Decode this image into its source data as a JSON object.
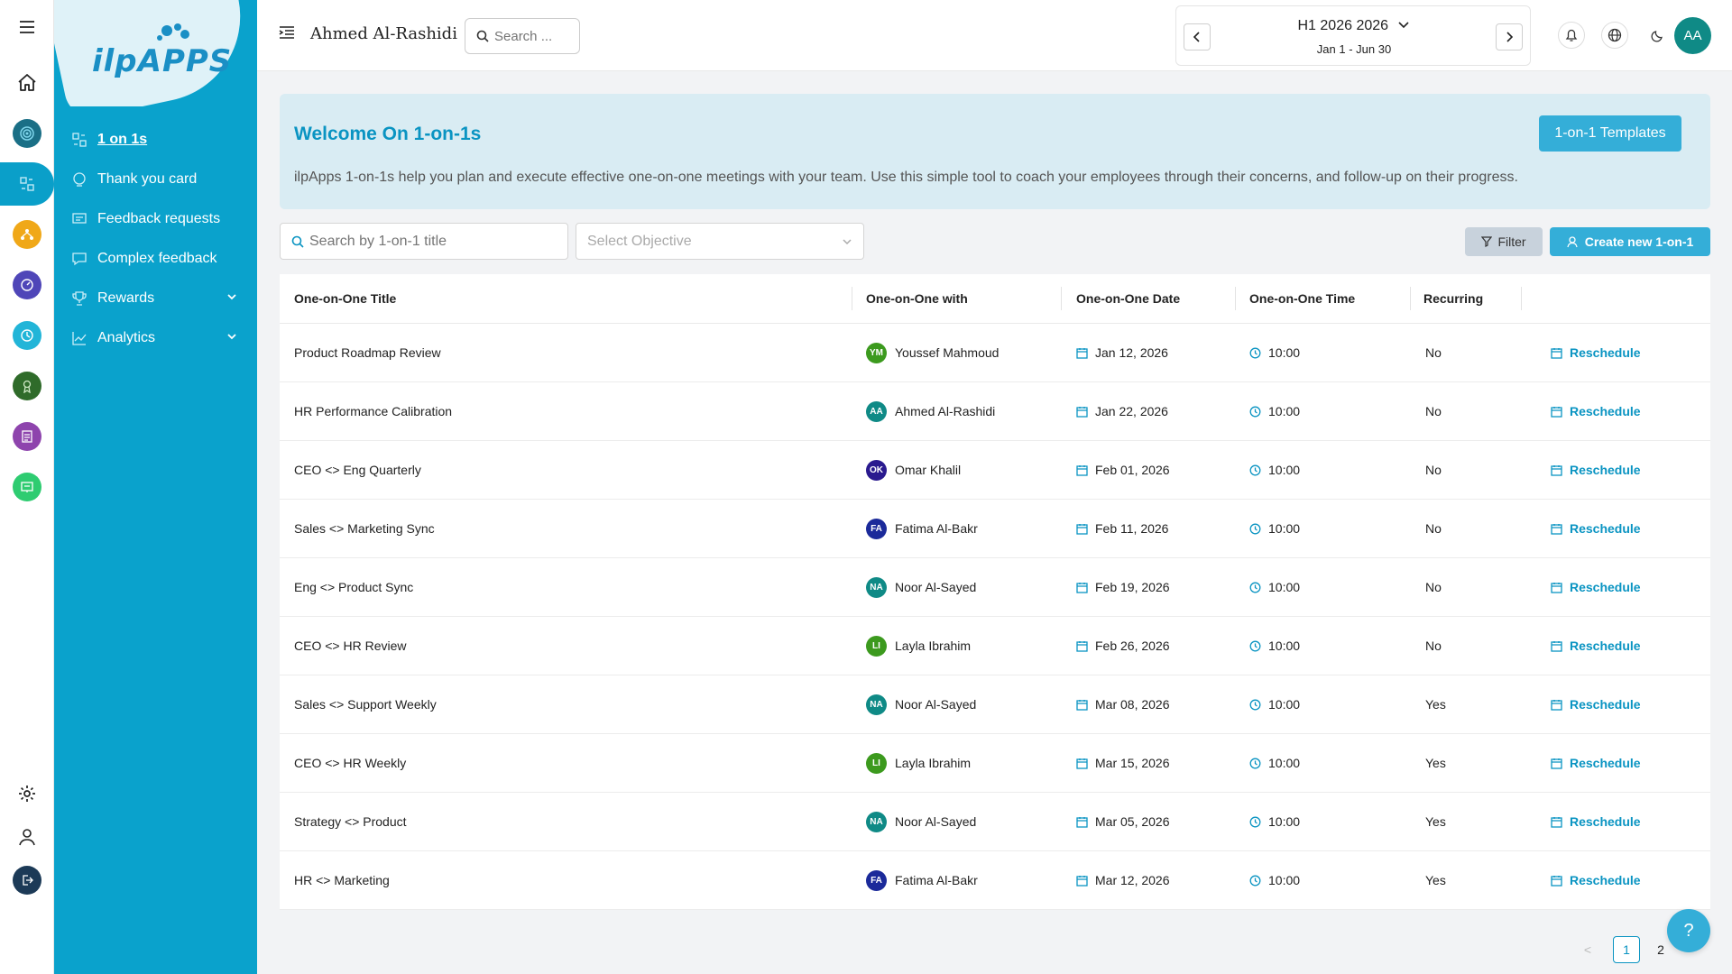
{
  "app": {
    "logo_text": "ilpAPPS",
    "accent": "#0aa2cc",
    "button_color": "#34aed8"
  },
  "rail": {
    "items": [
      {
        "name": "menu-icon"
      },
      {
        "name": "home-icon"
      },
      {
        "name": "target-icon",
        "color": "#1a6f86"
      },
      {
        "name": "one-on-one-icon",
        "color": "#0aa2cc",
        "active": true
      },
      {
        "name": "network-icon",
        "color": "#f0a818"
      },
      {
        "name": "speedometer-icon",
        "color": "#4f46b8"
      },
      {
        "name": "clock-icon",
        "color": "#22b5d8"
      },
      {
        "name": "award-icon",
        "color": "#2f6b2a"
      },
      {
        "name": "survey-icon",
        "color": "#8e44ad"
      },
      {
        "name": "board-icon",
        "color": "#2ecc71"
      },
      {
        "name": "settings-icon"
      },
      {
        "name": "user-icon"
      },
      {
        "name": "logout-icon",
        "color": "#1c3a57"
      }
    ]
  },
  "sidebar": {
    "items": [
      {
        "label": "1 on 1s",
        "active": true,
        "icon": "people-icon"
      },
      {
        "label": "Thank you card",
        "icon": "thank-you-icon"
      },
      {
        "label": "Feedback requests",
        "icon": "feedback-request-icon"
      },
      {
        "label": "Complex feedback",
        "icon": "complex-feedback-icon"
      },
      {
        "label": "Rewards",
        "icon": "trophy-icon",
        "expandable": true
      },
      {
        "label": "Analytics",
        "icon": "chart-icon",
        "expandable": true
      }
    ]
  },
  "header": {
    "user_name": "Ahmed Al-Rashidi",
    "search_placeholder": "Search ...",
    "period_title": "H1 2026 2026",
    "period_range": "Jan 1 - Jun 30",
    "avatar_initials": "AA"
  },
  "banner": {
    "title": "Welcome On 1-on-1s",
    "text": "ilpApps 1-on-1s help you plan and execute effective one-on-one meetings with your team. Use this simple tool to coach your employees through their concerns, and follow-up on their progress.",
    "templates_button": "1-on-1 Templates"
  },
  "toolbar": {
    "search_placeholder": "Search by 1-on-1 title",
    "objective_placeholder": "Select Objective",
    "filter_label": "Filter",
    "create_label": "Create new 1-on-1"
  },
  "table": {
    "columns": [
      "One-on-One Title",
      "One-on-One with",
      "One-on-One Date",
      "One-on-One Time",
      "Recurring"
    ],
    "action_label": "Reschedule",
    "rows": [
      {
        "title": "Product Roadmap Review",
        "with": "Youssef Mahmoud",
        "initials": "YM",
        "avatar_color": "#3c9a1e",
        "date": "Jan 12, 2026",
        "time": "10:00",
        "recurring": "No"
      },
      {
        "title": "HR Performance Calibration",
        "with": "Ahmed Al-Rashidi",
        "initials": "AA",
        "avatar_color": "#0f8a86",
        "date": "Jan 22, 2026",
        "time": "10:00",
        "recurring": "No"
      },
      {
        "title": "CEO <> Eng Quarterly",
        "with": "Omar Khalil",
        "initials": "OK",
        "avatar_color": "#2a1a8f",
        "date": "Feb 01, 2026",
        "time": "10:00",
        "recurring": "No"
      },
      {
        "title": "Sales <> Marketing Sync",
        "with": "Fatima Al-Bakr",
        "initials": "FA",
        "avatar_color": "#1b2a9a",
        "date": "Feb 11, 2026",
        "time": "10:00",
        "recurring": "No"
      },
      {
        "title": "Eng <> Product Sync",
        "with": "Noor Al-Sayed",
        "initials": "NA",
        "avatar_color": "#0f8a86",
        "date": "Feb 19, 2026",
        "time": "10:00",
        "recurring": "No"
      },
      {
        "title": "CEO <> HR Review",
        "with": "Layla Ibrahim",
        "initials": "LI",
        "avatar_color": "#3c9a1e",
        "date": "Feb 26, 2026",
        "time": "10:00",
        "recurring": "No"
      },
      {
        "title": "Sales <> Support Weekly",
        "with": "Noor Al-Sayed",
        "initials": "NA",
        "avatar_color": "#0f8a86",
        "date": "Mar 08, 2026",
        "time": "10:00",
        "recurring": "Yes"
      },
      {
        "title": "CEO <> HR Weekly",
        "with": "Layla Ibrahim",
        "initials": "LI",
        "avatar_color": "#3c9a1e",
        "date": "Mar 15, 2026",
        "time": "10:00",
        "recurring": "Yes"
      },
      {
        "title": "Strategy <> Product",
        "with": "Noor Al-Sayed",
        "initials": "NA",
        "avatar_color": "#0f8a86",
        "date": "Mar 05, 2026",
        "time": "10:00",
        "recurring": "Yes"
      },
      {
        "title": "HR <> Marketing",
        "with": "Fatima Al-Bakr",
        "initials": "FA",
        "avatar_color": "#1b2a9a",
        "date": "Mar 12, 2026",
        "time": "10:00",
        "recurring": "Yes"
      }
    ]
  },
  "pagination": {
    "prev": "<",
    "pages": [
      "1",
      "2"
    ],
    "current": "1"
  },
  "help_label": "?"
}
